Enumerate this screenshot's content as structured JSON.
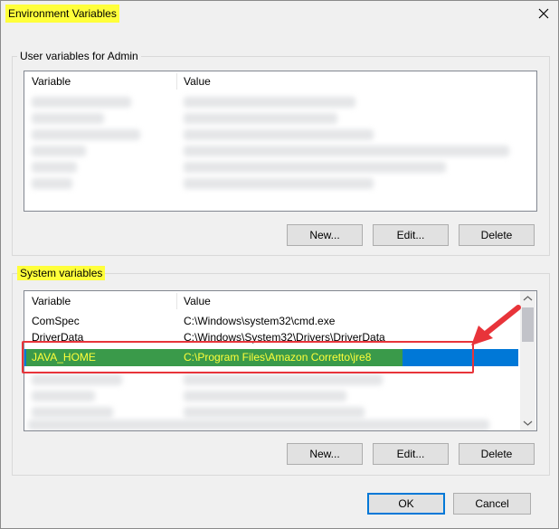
{
  "window": {
    "title": "Environment Variables"
  },
  "user_group": {
    "label": "User variables for Admin",
    "columns": [
      "Variable",
      "Value"
    ],
    "buttons": {
      "new": "New...",
      "edit": "Edit...",
      "delete": "Delete"
    }
  },
  "system_group": {
    "label": "System variables",
    "columns": [
      "Variable",
      "Value"
    ],
    "rows": [
      {
        "variable": "ComSpec",
        "value": "C:\\Windows\\system32\\cmd.exe"
      },
      {
        "variable": "DriverData",
        "value": "C:\\Windows\\System32\\Drivers\\DriverData"
      },
      {
        "variable": "JAVA_HOME",
        "value": "C:\\Program Files\\Amazon Corretto\\jre8"
      }
    ],
    "buttons": {
      "new": "New...",
      "edit": "Edit...",
      "delete": "Delete"
    }
  },
  "footer": {
    "ok": "OK",
    "cancel": "Cancel"
  },
  "colors": {
    "highlight_yellow": "#ffff3a",
    "selection_blue": "#0078d7",
    "selection_green": "#3a9a4a",
    "annotation_red": "#e8343a"
  }
}
